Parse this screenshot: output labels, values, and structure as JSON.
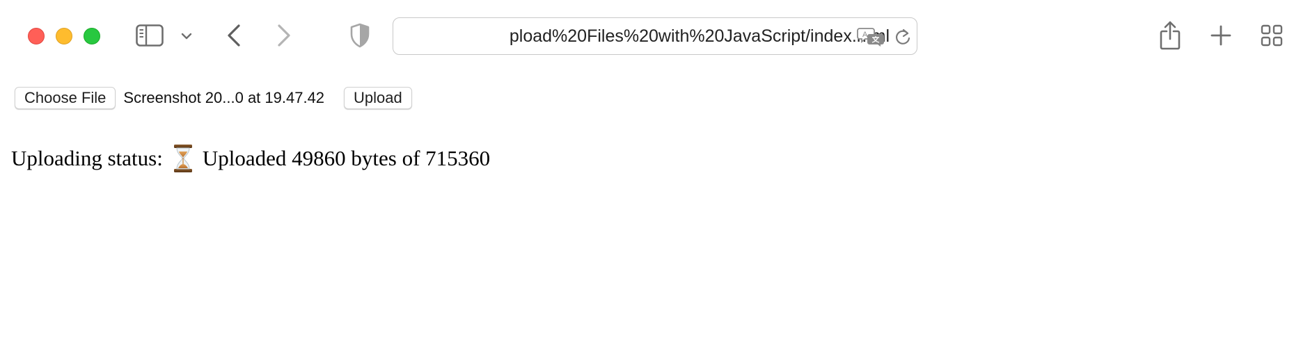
{
  "browser": {
    "url_display": "pload%20Files%20with%20JavaScript/index.html",
    "icons": {
      "sidebar": "sidebar-icon",
      "sidebar_menu": "chevron-down-icon",
      "back": "chevron-left-icon",
      "forward": "chevron-right-icon",
      "privacy": "shield-icon",
      "translate": "translate-icon",
      "reload": "reload-icon",
      "share": "share-icon",
      "new_tab": "plus-icon",
      "tab_overview": "grid-icon"
    },
    "colors": {
      "close": "#ff5f57",
      "minimize": "#febc2e",
      "zoom": "#28c840"
    }
  },
  "form": {
    "choose_file_label": "Choose File",
    "file_name": "Screenshot 20...0 at 19.47.42",
    "upload_label": "Upload"
  },
  "status": {
    "label": "Uploading status:",
    "icon": "hourglass-icon",
    "message": "Uploaded 49860 bytes of 715360"
  }
}
